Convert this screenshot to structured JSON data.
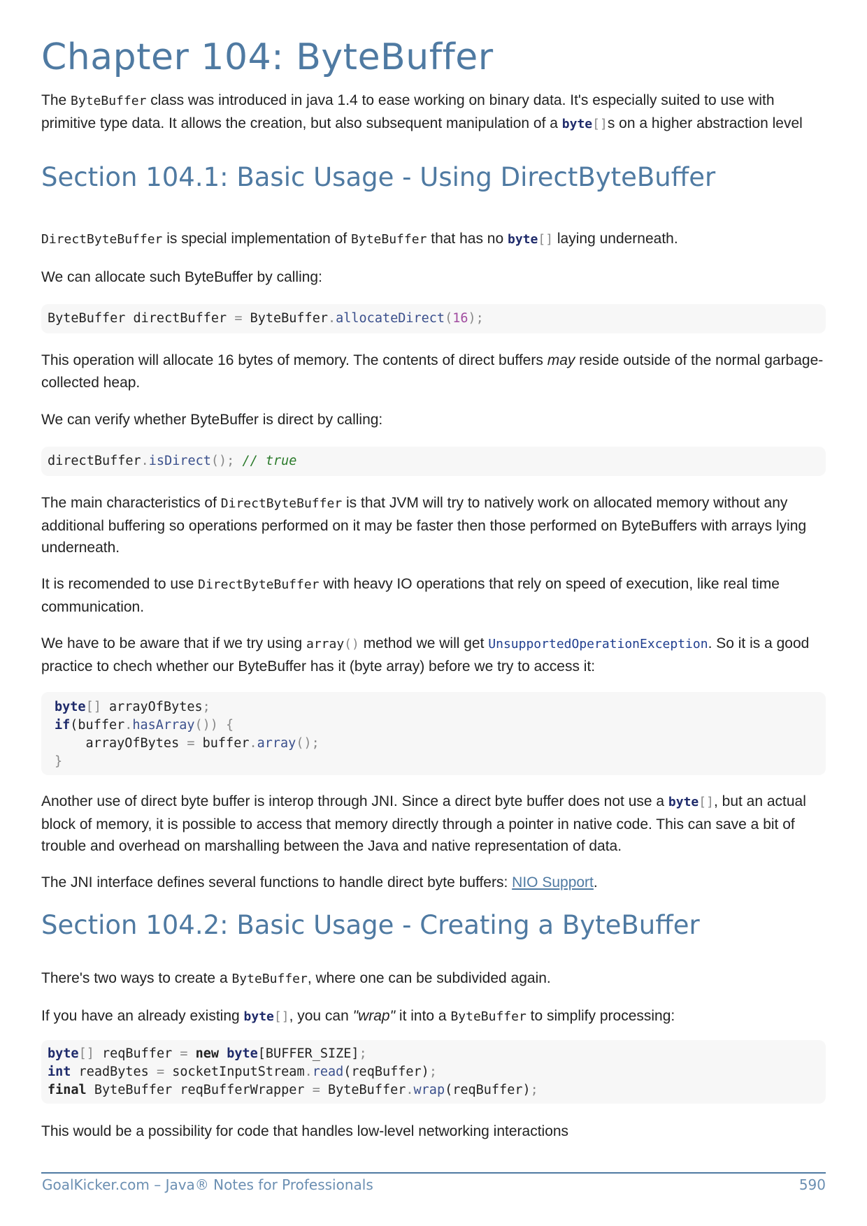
{
  "chapter": {
    "title": "Chapter 104: ByteBuffer"
  },
  "intro": {
    "t1": "The ",
    "c1": "ByteBuffer",
    "t2": " class was introduced in java 1.4 to ease working on binary data. It's especially suited to use with primitive type data. It allows the creation, but also subsequent manipulation of a ",
    "c2_kw": "byte",
    "c2_br": "[]",
    "t3": "s on a higher abstraction level"
  },
  "section1": {
    "title": "Section 104.1: Basic Usage - Using DirectByteBuffer",
    "p1": {
      "c1": "DirectByteBuffer",
      "t1": " is special implementation of ",
      "c2": "ByteBuffer",
      "t2": " that has no ",
      "c3_kw": "byte",
      "c3_br": "[]",
      "t3": " laying underneath."
    },
    "p2": "We can allocate such ByteBuffer by calling:",
    "code1": {
      "a": "ByteBuffer directBuffer ",
      "eq": "=",
      "b": " ByteBuffer",
      "dot": ".",
      "fn": "allocateDirect",
      "lp": "(",
      "num": "16",
      "rp": ");"
    },
    "p3": {
      "t1": "This operation will allocate 16 bytes of memory. The contents of direct buffers ",
      "em": "may",
      "t2": " reside outside of the normal garbage-collected heap."
    },
    "p4": "We can verify whether ByteBuffer is direct by calling:",
    "code2": {
      "a": "directBuffer",
      "dot": ".",
      "fn": "isDirect",
      "p": "();",
      "cm": " // true"
    },
    "p5": {
      "t1": "The main characteristics of ",
      "c1": "DirectByteBuffer",
      "t2": " is that JVM will try to natively work on allocated memory without any additional buffering so operations performed on it may be faster then those performed on ByteBuffers with arrays lying underneath."
    },
    "p6": {
      "t1": "It is recomended to use ",
      "c1": "DirectByteBuffer",
      "t2": " with heavy IO operations that rely on speed of execution, like real time communication."
    },
    "p7": {
      "t1": "We have to be aware that if we try using ",
      "c1": "array",
      "c1p": "()",
      "t2": " method we will get ",
      "c2": "UnsupportedOperationException",
      "t3": ". So it is a good practice to chech whether our ByteBuffer has it (byte array) before we try to access it:"
    },
    "code3": {
      "l1_kw": "byte",
      "l1_br": "[]",
      "l1_rest": " arrayOfBytes",
      "l1_semi": ";",
      "l2_kw": "if",
      "l2_a": "(buffer",
      "l2_dot": ".",
      "l2_fn": "hasArray",
      "l2_b": "()) {",
      "l3_a": "    arrayOfBytes ",
      "l3_eq": "=",
      "l3_b": " buffer",
      "l3_dot": ".",
      "l3_fn": "array",
      "l3_c": "();",
      "l4": "}"
    },
    "p8": {
      "t1": "Another use of direct byte buffer is interop through JNI. Since a direct byte buffer does not use a ",
      "c1_kw": "byte",
      "c1_br": "[]",
      "t2": ", but an actual block of memory, it is possible to access that memory directly through a pointer in native code. This can save a bit of trouble and overhead on marshalling between the Java and native representation of data."
    },
    "p9": {
      "t1": "The JNI interface defines several functions to handle direct byte buffers: ",
      "link": "NIO Support",
      "t2": "."
    }
  },
  "section2": {
    "title": "Section 104.2: Basic Usage - Creating a ByteBuffer",
    "p1": {
      "t1": "There's two ways to create a ",
      "c1": "ByteBuffer",
      "t2": ", where one can be subdivided again."
    },
    "p2": {
      "t1": "If you have an already existing ",
      "c1_kw": "byte",
      "c1_br": "[]",
      "t2": ", you can ",
      "em": "\"wrap\"",
      "t3": " it into a ",
      "c2": "ByteBuffer",
      "t4": " to simplify processing:"
    },
    "code4": {
      "l1_kw": "byte",
      "l1_br": "[]",
      "l1_a": " reqBuffer ",
      "l1_eq": "=",
      "l1_sp": " ",
      "l1_new": "new",
      "l1_sp2": " ",
      "l1_kw2": "byte",
      "l1_b": "[BUFFER_SIZE]",
      "l1_semi": ";",
      "l2_kw": "int",
      "l2_a": " readBytes ",
      "l2_eq": "=",
      "l2_b": " socketInputStream",
      "l2_dot": ".",
      "l2_fn": "read",
      "l2_c": "(reqBuffer)",
      "l2_semi": ";",
      "l3_kw": "final",
      "l3_a": " ByteBuffer reqBufferWrapper ",
      "l3_eq": "=",
      "l3_b": " ByteBuffer",
      "l3_dot": ".",
      "l3_fn": "wrap",
      "l3_c": "(reqBuffer)",
      "l3_semi": ";"
    },
    "p3": "This would be a possibility for code that handles low-level networking interactions"
  },
  "footer": {
    "left": "GoalKicker.com – Java® Notes for Professionals",
    "page": "590"
  }
}
